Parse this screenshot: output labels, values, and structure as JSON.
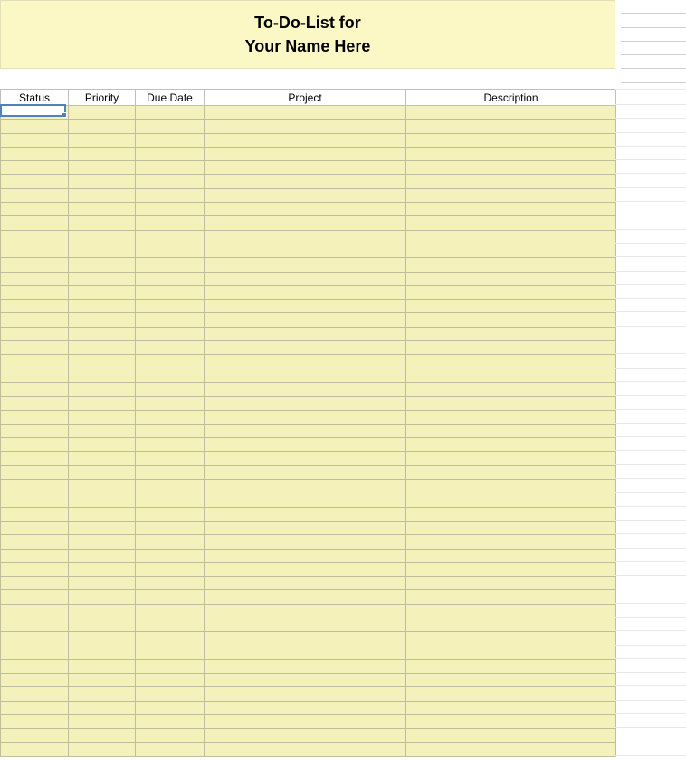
{
  "title": {
    "line1": "To-Do-List for",
    "line2": "Your Name Here"
  },
  "columns": [
    {
      "key": "status",
      "label": "Status"
    },
    {
      "key": "priority",
      "label": "Priority"
    },
    {
      "key": "duedate",
      "label": "Due Date"
    },
    {
      "key": "project",
      "label": "Project"
    },
    {
      "key": "description",
      "label": "Description"
    }
  ],
  "row_count": 47,
  "rows": [],
  "selected_cell": {
    "row": 0,
    "col": 0
  },
  "colors": {
    "title_bg": "#fbf8c6",
    "row_bg": "#f4f1bb",
    "selection_border": "#4f81bd"
  }
}
